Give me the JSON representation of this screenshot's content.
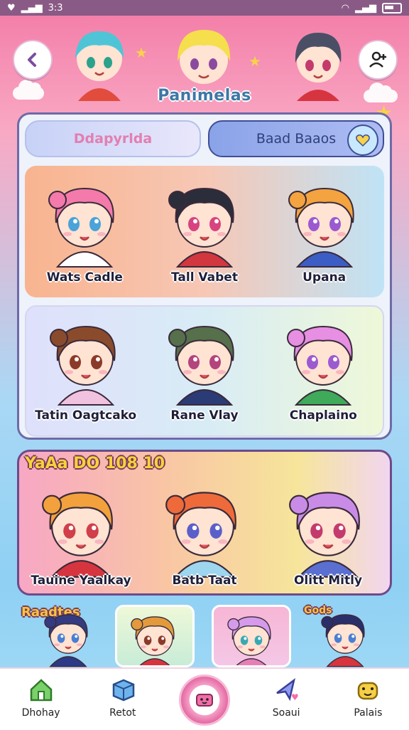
{
  "status_bar": {
    "time": "3:3",
    "left_icons": [
      "heart-icon",
      "signal-icon"
    ],
    "right_icons": [
      "wifi-icon",
      "signal-icon",
      "battery-icon"
    ]
  },
  "header": {
    "title": "Panimelas",
    "back_icon": "chevron-left-icon",
    "profile_icon": "user-add-icon"
  },
  "tabs": [
    {
      "label": "Ddapyrlda",
      "active": true
    },
    {
      "label": "Baad Baaos",
      "icon": "heart-chat-icon"
    }
  ],
  "grid": {
    "row1": [
      {
        "name": "Wats Cadle",
        "hair": "#f47aac",
        "skin": "#ffe3d3",
        "eye": "#4aa3d9",
        "shirt": "#ffffff"
      },
      {
        "name": "Tall Vabet",
        "hair": "#2b2d3a",
        "skin": "#ffe3d3",
        "eye": "#d8447f",
        "shirt": "#d2363e"
      },
      {
        "name": "Upana",
        "hair": "#f3a33f",
        "skin": "#ffe3d3",
        "eye": "#9c5ad1",
        "shirt": "#3c5dc4"
      }
    ],
    "row2": [
      {
        "name": "Tatin Oagtcako",
        "hair": "#8a4b2d",
        "skin": "#ffe3d3",
        "eye": "#8b3a2a",
        "shirt": "#f1c2e0"
      },
      {
        "name": "Rane Vlay",
        "hair": "#55704a",
        "skin": "#ffe3d3",
        "eye": "#b3447e",
        "shirt": "#2a3b75"
      },
      {
        "name": "Chaplaino",
        "hair": "#e78fe3",
        "skin": "#ffe3d3",
        "eye": "#9c5ad1",
        "shirt": "#3faa5a"
      }
    ]
  },
  "featured": {
    "title": "YaAa DO 108 10",
    "characters": [
      {
        "name": "Tauine Yaalkay",
        "hair": "#f2a13d",
        "skin": "#ffe3d3",
        "eye": "#d03f4a",
        "shirt": "#d6353f"
      },
      {
        "name": "Batb Taat",
        "hair": "#ef6a3a",
        "skin": "#ffe3d3",
        "eye": "#5b5fc9",
        "shirt": "#9dd6ee"
      },
      {
        "name": "Olitt Mitly",
        "hair": "#c98ce6",
        "skin": "#ffe3d3",
        "eye": "#c43a6d",
        "shirt": "#5a6fd0"
      }
    ]
  },
  "mini_strip": {
    "left_label": "Raadtes",
    "right_label": "Gods",
    "cards": [
      {
        "hair": "#343b80",
        "skin": "#ffe3d3",
        "eye": "#4a7ed0",
        "shirt": "#2d3a86"
      },
      {
        "hair": "#e29a3c",
        "skin": "#ffe3d3",
        "eye": "#8b3a2a",
        "shirt": "#d6353f"
      },
      {
        "hair": "#d59bea",
        "skin": "#ffe3d3",
        "eye": "#3aa8b4",
        "shirt": "#e67fb7"
      },
      {
        "hair": "#2a2f6a",
        "skin": "#ffe3d3",
        "eye": "#4a7ed0",
        "shirt": "#d6353f"
      }
    ]
  },
  "bottom_nav": [
    {
      "label": "Dhohay",
      "icon": "home-icon",
      "color": "#55b84a"
    },
    {
      "label": "Retot",
      "icon": "cube-icon",
      "color": "#4b8fd4"
    },
    {
      "label": "",
      "icon": "camera-icon",
      "color": "#e46aa3"
    },
    {
      "label": "Soaui",
      "icon": "star-icon",
      "color": "#6e7fe0"
    },
    {
      "label": "Palais",
      "icon": "frog-icon",
      "color": "#f2c23a"
    }
  ]
}
